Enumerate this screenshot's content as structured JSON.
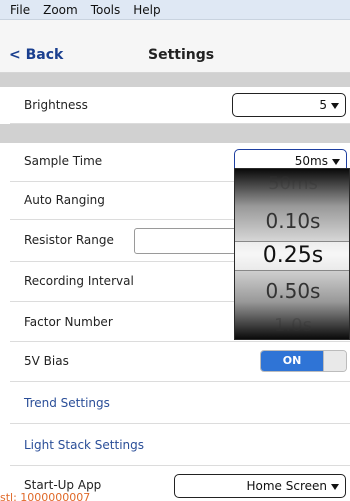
{
  "menu": {
    "file": "File",
    "zoom": "Zoom",
    "tools": "Tools",
    "help": "Help"
  },
  "nav": {
    "back": "< Back",
    "title": "Settings"
  },
  "settings": {
    "brightness": {
      "label": "Brightness",
      "value": "5"
    },
    "sample_time": {
      "label": "Sample Time",
      "value": "50ms"
    },
    "auto_ranging": {
      "label": "Auto Ranging"
    },
    "resistor_range": {
      "label": "Resistor Range"
    },
    "recording_interval": {
      "label": "Recording Interval"
    },
    "factor_number": {
      "label": "Factor Number"
    },
    "bias": {
      "label": "5V Bias",
      "toggle": "ON"
    },
    "trend_settings": {
      "label": "Trend Settings"
    },
    "light_stack_settings": {
      "label": "Light Stack Settings"
    },
    "startup_app": {
      "label": "Start-Up App",
      "value": "Home Screen"
    }
  },
  "picker": {
    "items": [
      "50ms",
      "0.10s",
      "0.25s",
      "0.50s",
      "1.0s"
    ],
    "selected": "0.25s"
  },
  "watermark": "stl: 1000000007"
}
